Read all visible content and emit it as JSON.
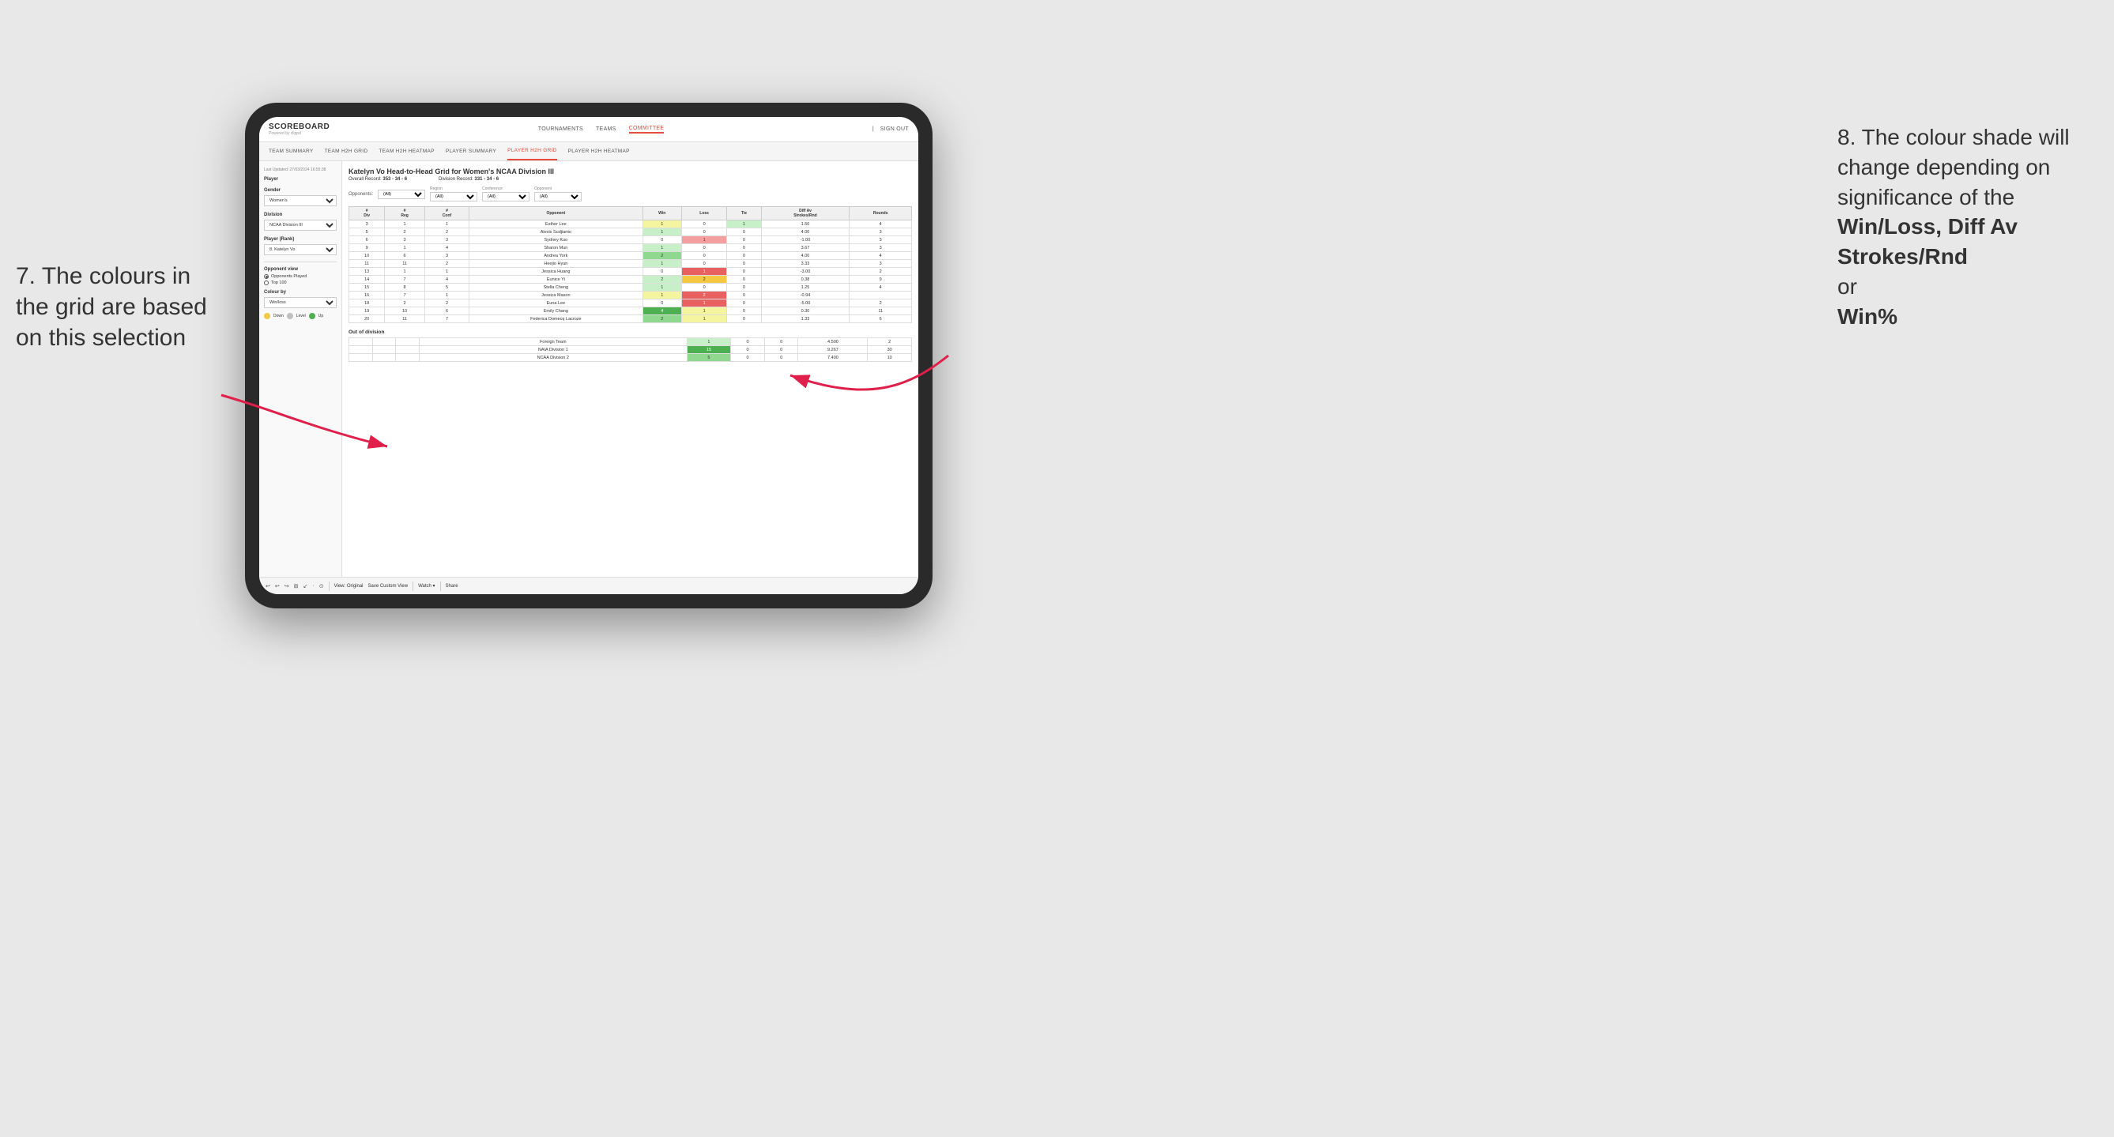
{
  "annotations": {
    "left": {
      "text": "7. The colours in the grid are based on this selection"
    },
    "right": {
      "intro": "8. The colour shade will change depending on significance of the",
      "bold1": "Win/Loss,",
      "bold2": "Diff Av Strokes/Rnd",
      "conjunction": "or",
      "bold3": "Win%"
    }
  },
  "nav": {
    "logo": "SCOREBOARD",
    "powered_by": "Powered by clippd",
    "links": [
      "TOURNAMENTS",
      "TEAMS",
      "COMMITTEE"
    ],
    "sign_in": "Sign out"
  },
  "sub_nav": {
    "links": [
      "TEAM SUMMARY",
      "TEAM H2H GRID",
      "TEAM H2H HEATMAP",
      "PLAYER SUMMARY",
      "PLAYER H2H GRID",
      "PLAYER H2H HEATMAP"
    ]
  },
  "sidebar": {
    "timestamp": "Last Updated: 27/03/2024 16:55:38",
    "player_label": "Player",
    "gender_label": "Gender",
    "gender_value": "Women's",
    "division_label": "Division",
    "division_value": "NCAA Division III",
    "player_rank_label": "Player (Rank)",
    "player_rank_value": "8. Katelyn Vo",
    "opponent_view_label": "Opponent view",
    "opponent_options": [
      "Opponents Played",
      "Top 100"
    ],
    "opponent_selected": "Opponents Played",
    "colour_by_label": "Colour by",
    "colour_by_value": "Win/loss",
    "legend": {
      "down_color": "#f5c842",
      "level_color": "#c0c0c0",
      "up_color": "#4caf50",
      "down_label": "Down",
      "level_label": "Level",
      "up_label": "Up"
    }
  },
  "grid": {
    "title": "Katelyn Vo Head-to-Head Grid for Women's NCAA Division III",
    "overall_record_label": "Overall Record:",
    "overall_record_value": "353 - 34 - 6",
    "division_record_label": "Division Record:",
    "division_record_value": "331 - 34 - 6",
    "filters": {
      "opponents_label": "Opponents:",
      "opponents_value": "(All)",
      "region_label": "Region",
      "region_value": "(All)",
      "conference_label": "Conference",
      "conference_value": "(All)",
      "opponent_label": "Opponent",
      "opponent_value": "(All)"
    },
    "col_headers": [
      "#\nDiv",
      "#\nReg",
      "#\nConf",
      "Opponent",
      "Win",
      "Loss",
      "Tie",
      "Diff Av\nStrokes/Rnd",
      "Rounds"
    ],
    "rows": [
      {
        "div": "3",
        "reg": "1",
        "conf": "1",
        "opponent": "Esther Lee",
        "win": 1,
        "loss": 0,
        "tie": 1,
        "diff": "1.50",
        "rounds": "4",
        "win_cell": "yellow",
        "loss_cell": "empty",
        "tie_cell": "green-light"
      },
      {
        "div": "5",
        "reg": "2",
        "conf": "2",
        "opponent": "Alexis Sudjianto",
        "win": 1,
        "loss": 0,
        "tie": 0,
        "diff": "4.00",
        "rounds": "3",
        "win_cell": "green-light",
        "loss_cell": "empty",
        "tie_cell": "empty"
      },
      {
        "div": "6",
        "reg": "3",
        "conf": "3",
        "opponent": "Sydney Kuo",
        "win": 0,
        "loss": 1,
        "tie": 0,
        "diff": "-1.00",
        "rounds": "3",
        "win_cell": "empty",
        "loss_cell": "red-light",
        "tie_cell": "empty"
      },
      {
        "div": "9",
        "reg": "1",
        "conf": "4",
        "opponent": "Sharon Mun",
        "win": 1,
        "loss": 0,
        "tie": 0,
        "diff": "3.67",
        "rounds": "3",
        "win_cell": "green-light",
        "loss_cell": "empty",
        "tie_cell": "empty"
      },
      {
        "div": "10",
        "reg": "6",
        "conf": "3",
        "opponent": "Andrea York",
        "win": 2,
        "loss": 0,
        "tie": 0,
        "diff": "4.00",
        "rounds": "4",
        "win_cell": "green-mid",
        "loss_cell": "empty",
        "tie_cell": "empty"
      },
      {
        "div": "11",
        "reg": "11",
        "conf": "2",
        "opponent": "Heejio Hyun",
        "win": 1,
        "loss": 0,
        "tie": 0,
        "diff": "3.33",
        "rounds": "3",
        "win_cell": "green-light",
        "loss_cell": "empty",
        "tie_cell": "empty"
      },
      {
        "div": "13",
        "reg": "1",
        "conf": "1",
        "opponent": "Jessica Huang",
        "win": 0,
        "loss": 1,
        "tie": 0,
        "diff": "-3.00",
        "rounds": "2",
        "win_cell": "empty",
        "loss_cell": "red-mid",
        "tie_cell": "empty"
      },
      {
        "div": "14",
        "reg": "7",
        "conf": "4",
        "opponent": "Eunice Yi",
        "win": 2,
        "loss": 2,
        "tie": 0,
        "diff": "0.38",
        "rounds": "9",
        "win_cell": "green-light",
        "loss_cell": "orange",
        "tie_cell": "empty"
      },
      {
        "div": "15",
        "reg": "8",
        "conf": "5",
        "opponent": "Stella Cheng",
        "win": 1,
        "loss": 0,
        "tie": 0,
        "diff": "1.25",
        "rounds": "4",
        "win_cell": "green-light",
        "loss_cell": "empty",
        "tie_cell": "empty"
      },
      {
        "div": "16",
        "reg": "7",
        "conf": "1",
        "opponent": "Jessica Mason",
        "win": 1,
        "loss": 2,
        "tie": 0,
        "diff": "-0.94",
        "rounds": "",
        "win_cell": "yellow",
        "loss_cell": "red-mid",
        "tie_cell": "empty"
      },
      {
        "div": "18",
        "reg": "2",
        "conf": "2",
        "opponent": "Euna Lee",
        "win": 0,
        "loss": 1,
        "tie": 0,
        "diff": "-5.00",
        "rounds": "2",
        "win_cell": "empty",
        "loss_cell": "red-mid",
        "tie_cell": "empty"
      },
      {
        "div": "19",
        "reg": "10",
        "conf": "6",
        "opponent": "Emily Chang",
        "win": 4,
        "loss": 1,
        "tie": 0,
        "diff": "0.30",
        "rounds": "11",
        "win_cell": "green-strong",
        "loss_cell": "yellow",
        "tie_cell": "empty"
      },
      {
        "div": "20",
        "reg": "11",
        "conf": "7",
        "opponent": "Federica Domecq Lacroze",
        "win": 2,
        "loss": 1,
        "tie": 0,
        "diff": "1.33",
        "rounds": "6",
        "win_cell": "green-mid",
        "loss_cell": "yellow",
        "tie_cell": "empty"
      }
    ],
    "out_of_division_label": "Out of division",
    "out_of_division_rows": [
      {
        "opponent": "Foreign Team",
        "win": 1,
        "loss": 0,
        "tie": 0,
        "diff": "4.500",
        "rounds": "2",
        "win_cell": "green-light",
        "loss_cell": "empty",
        "tie_cell": "empty"
      },
      {
        "opponent": "NAIA Division 1",
        "win": 15,
        "loss": 0,
        "tie": 0,
        "diff": "9.267",
        "rounds": "30",
        "win_cell": "green-strong",
        "loss_cell": "empty",
        "tie_cell": "empty"
      },
      {
        "opponent": "NCAA Division 2",
        "win": 5,
        "loss": 0,
        "tie": 0,
        "diff": "7.400",
        "rounds": "10",
        "win_cell": "green-mid",
        "loss_cell": "empty",
        "tie_cell": "empty"
      }
    ]
  },
  "toolbar": {
    "buttons": [
      "↩",
      "↩",
      "↪",
      "⊞",
      "↙",
      "·",
      "⊙",
      "|",
      "View: Original",
      "Save Custom View",
      "Watch ▾",
      "|",
      "Share"
    ]
  }
}
